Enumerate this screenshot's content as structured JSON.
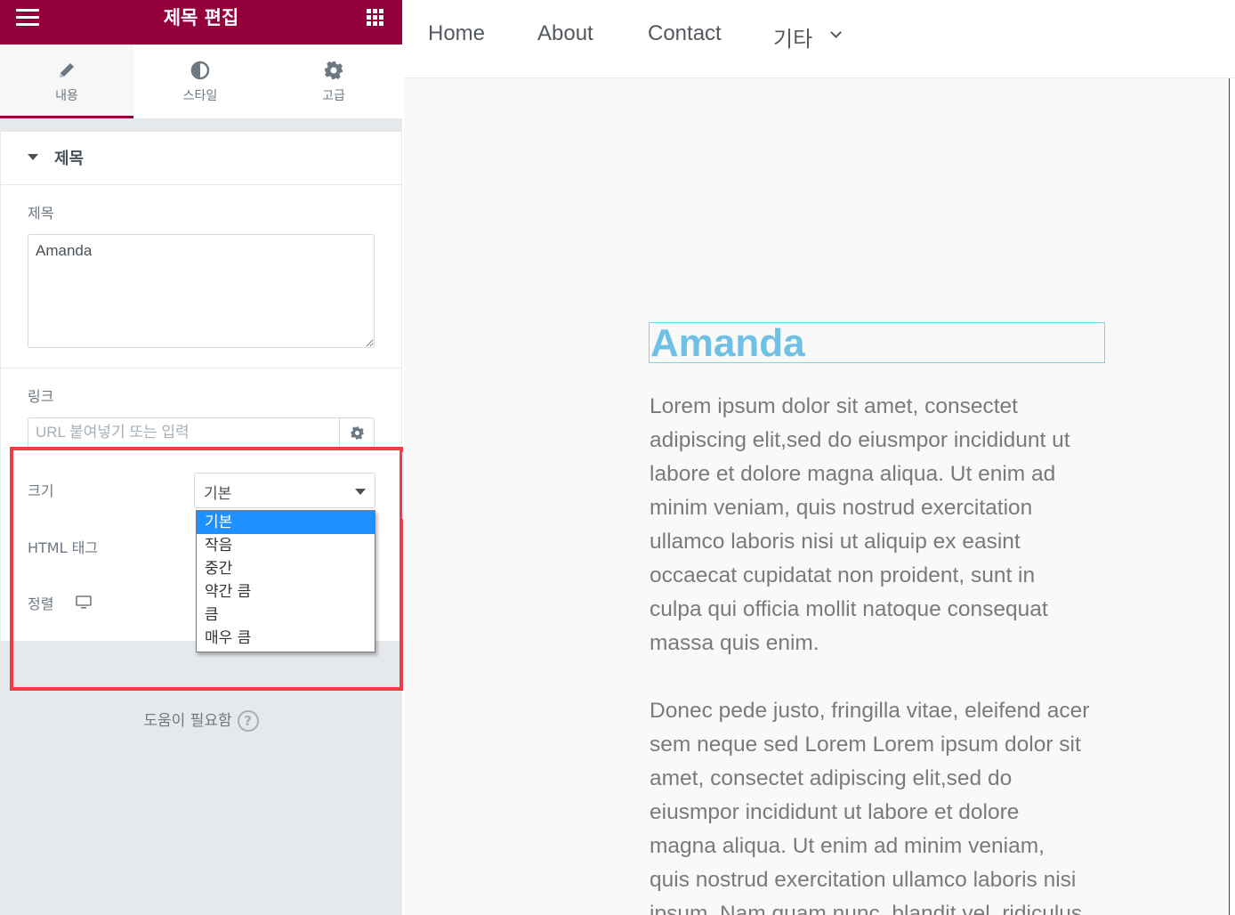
{
  "sidebar": {
    "header_title": "제목 편집",
    "tabs": [
      {
        "label": "내용",
        "icon": "pencil-icon"
      },
      {
        "label": "스타일",
        "icon": "half-circle-icon"
      },
      {
        "label": "고급",
        "icon": "gear-icon"
      }
    ],
    "section_title": "제목",
    "title_label": "제목",
    "title_value": "Amanda",
    "link_label": "링크",
    "link_placeholder": "URL 붙여넣기 또는 입력",
    "size_label": "크기",
    "size_selected": "기본",
    "size_options": [
      "기본",
      "작음",
      "중간",
      "약간 큼",
      "큼",
      "매우 큼"
    ],
    "html_tag_label": "HTML 태그",
    "align_label": "정렬",
    "help_text": "도움이 필요함",
    "help_icon": "?"
  },
  "colors": {
    "brand": "#93003c",
    "highlight": "#f03c45",
    "heading": "#6ec1e4",
    "selected_option": "#1e90ff"
  },
  "nav": {
    "items": [
      "Home",
      "About",
      "Contact",
      "기타"
    ]
  },
  "content": {
    "heading": "Amanda",
    "lines1": [
      "Lorem ipsum dolor sit amet, consectet",
      "adipiscing elit,sed do eiusmpor incididunt ut",
      "labore et dolore magna aliqua. Ut enim ad",
      "minim veniam, quis nostrud exercitation",
      "ullamco laboris nisi ut aliquip ex easint",
      "occaecat cupidatat non proident, sunt in",
      "culpa qui officia mollit natoque consequat",
      "massa quis enim."
    ],
    "lines2": [
      "Donec pede justo, fringilla vitae, eleifend acer",
      "sem neque sed Lorem Lorem ipsum dolor sit",
      "amet, consectet adipiscing elit,sed do",
      "eiusmpor incididunt ut labore et dolore",
      "magna aliqua. Ut enim ad minim veniam,",
      "quis nostrud exercitation ullamco laboris nisi",
      "ipsum. Nam quam nunc, blandit vel, ridiculus"
    ]
  }
}
